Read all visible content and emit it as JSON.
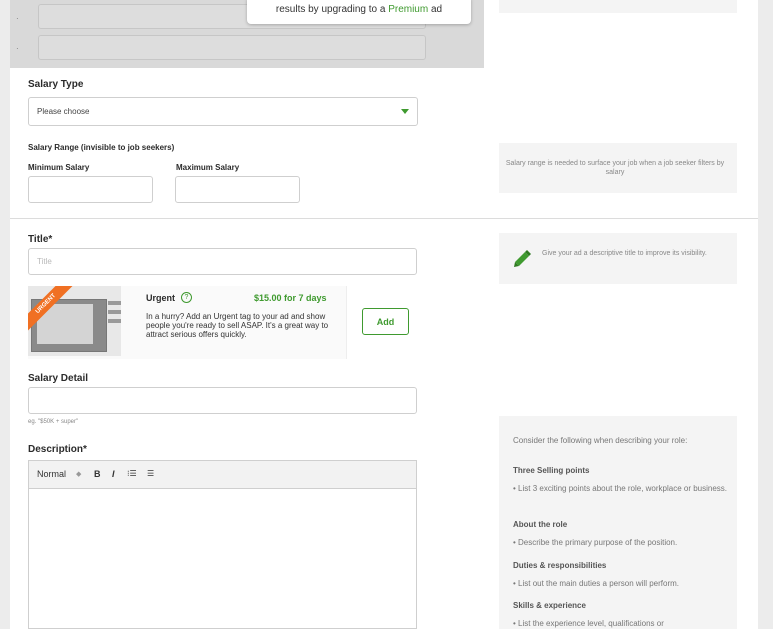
{
  "tooltip": {
    "prefix": "results by upgrading to a ",
    "highlight": "Premium",
    "suffix": " ad"
  },
  "bullets": [
    "·",
    "·"
  ],
  "salary_type": {
    "label": "Salary Type",
    "value": "Please choose"
  },
  "salary_range": {
    "label": "Salary Range (invisible to job seekers)",
    "min_label": "Minimum Salary",
    "max_label": "Maximum Salary",
    "tip": "Salary range is needed to surface your job when a job seeker filters by salary"
  },
  "title_field": {
    "label": "Title*",
    "placeholder": "Title",
    "tip": "Give your ad a descriptive title to improve its visibility."
  },
  "urgent": {
    "ribbon": "URGENT",
    "title": "Urgent",
    "help_icon": "?",
    "price": "$15.00  for 7 days",
    "description": "In a hurry? Add an Urgent tag to your ad and show people you're ready to sell ASAP. It's a great way to attract serious offers quickly.",
    "add_label": "Add"
  },
  "salary_detail": {
    "label": "Salary Detail",
    "hint": "eg. \"$50K + super\""
  },
  "description": {
    "label": "Description*",
    "toolbar": {
      "style": "Normal",
      "bold": "B",
      "italic": "I",
      "ol": "⁝☰",
      "ul": "☰"
    }
  },
  "desc_tip": {
    "intro": "Consider the following when describing your role:",
    "sections": [
      {
        "heading": "Three Selling points",
        "item": "• List 3 exciting points about the role, workplace or business."
      },
      {
        "heading": "About the role",
        "item": "• Describe the primary purpose of the position."
      },
      {
        "heading": "Duties & responsibilities",
        "item": "• List out the main duties a person will perform."
      },
      {
        "heading": "Skills & experience",
        "item": "• List the experience level, qualifications or"
      }
    ]
  },
  "colors": {
    "accent": "#3f9a2f",
    "urgent": "#f07023"
  },
  "icons": {
    "pencil": "pencil-icon",
    "caret": "chevron-down-icon",
    "help": "help-icon"
  }
}
